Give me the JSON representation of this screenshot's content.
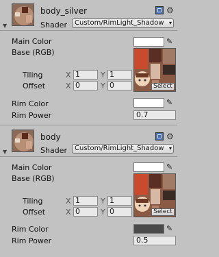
{
  "materials": [
    {
      "name": "body_silver",
      "shader_label": "Shader",
      "shader_value": "Custom/RimLight_Shadow",
      "main_color_label": "Main Color",
      "main_color": "#ffffff",
      "base_label": "Base (RGB)",
      "tiling_label": "Tiling",
      "offset_label": "Offset",
      "tiling_x": "1",
      "tiling_y": "1",
      "offset_x": "0",
      "offset_y": "0",
      "axis_x": "X",
      "axis_y": "Y",
      "select_label": "Select",
      "rim_color_label": "Rim Color",
      "rim_color": "#ffffff",
      "rim_power_label": "Rim Power",
      "rim_power": "0.7"
    },
    {
      "name": "body",
      "shader_label": "Shader",
      "shader_value": "Custom/RimLight_Shadow",
      "main_color_label": "Main Color",
      "main_color": "#ffffff",
      "base_label": "Base (RGB)",
      "tiling_label": "Tiling",
      "offset_label": "Offset",
      "tiling_x": "1",
      "tiling_y": "1",
      "offset_x": "0",
      "offset_y": "0",
      "axis_x": "X",
      "axis_y": "Y",
      "select_label": "Select",
      "rim_color_label": "Rim Color",
      "rim_color": "#4a4a4a",
      "rim_power_label": "Rim Power",
      "rim_power": "0.5"
    }
  ],
  "icons": {
    "help": "help-book-icon",
    "settings": "gear-icon",
    "picker": "eyedropper-icon",
    "foldout": "triangle-down-icon"
  }
}
